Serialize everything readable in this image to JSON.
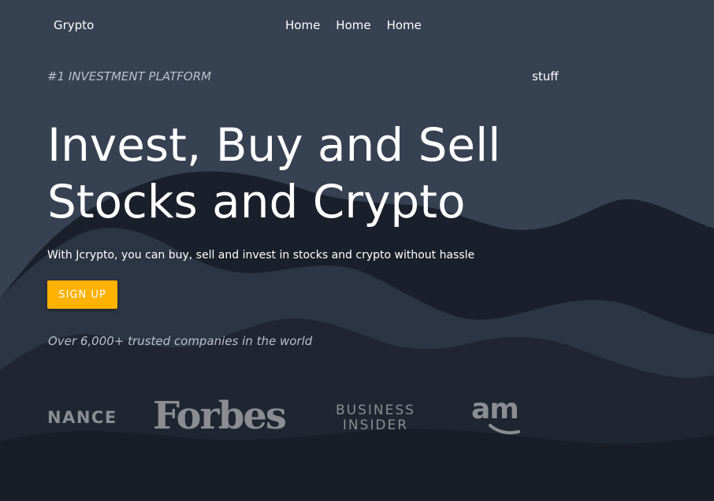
{
  "nav": {
    "brand": "Grypto",
    "links": [
      "Home",
      "Home",
      "Home"
    ]
  },
  "hero": {
    "eyebrow": "#1 INVESTMENT PLATFORM",
    "side_label": "stuff",
    "headline_line1": "Invest, Buy and Sell",
    "headline_line2": "Stocks and Crypto",
    "subtext": "With Jcrypto, you can buy, sell and invest in stocks and crypto without hassle",
    "cta_label": "SIGN UP",
    "trusted": "Over 6,000+ trusted companies in the world"
  },
  "logos": {
    "binance": "NANCE",
    "forbes": "Forbes",
    "business_insider_line1": "BUSINESS",
    "business_insider_line2": "INSIDER",
    "amazon": "am"
  },
  "colors": {
    "background_dark": "#1a202b",
    "wave_light": "#364152",
    "wave_mid": "#2c3544",
    "accent": "#ffb200",
    "logo_gray": "#8a8d92",
    "muted_text": "#b8c0cc"
  }
}
